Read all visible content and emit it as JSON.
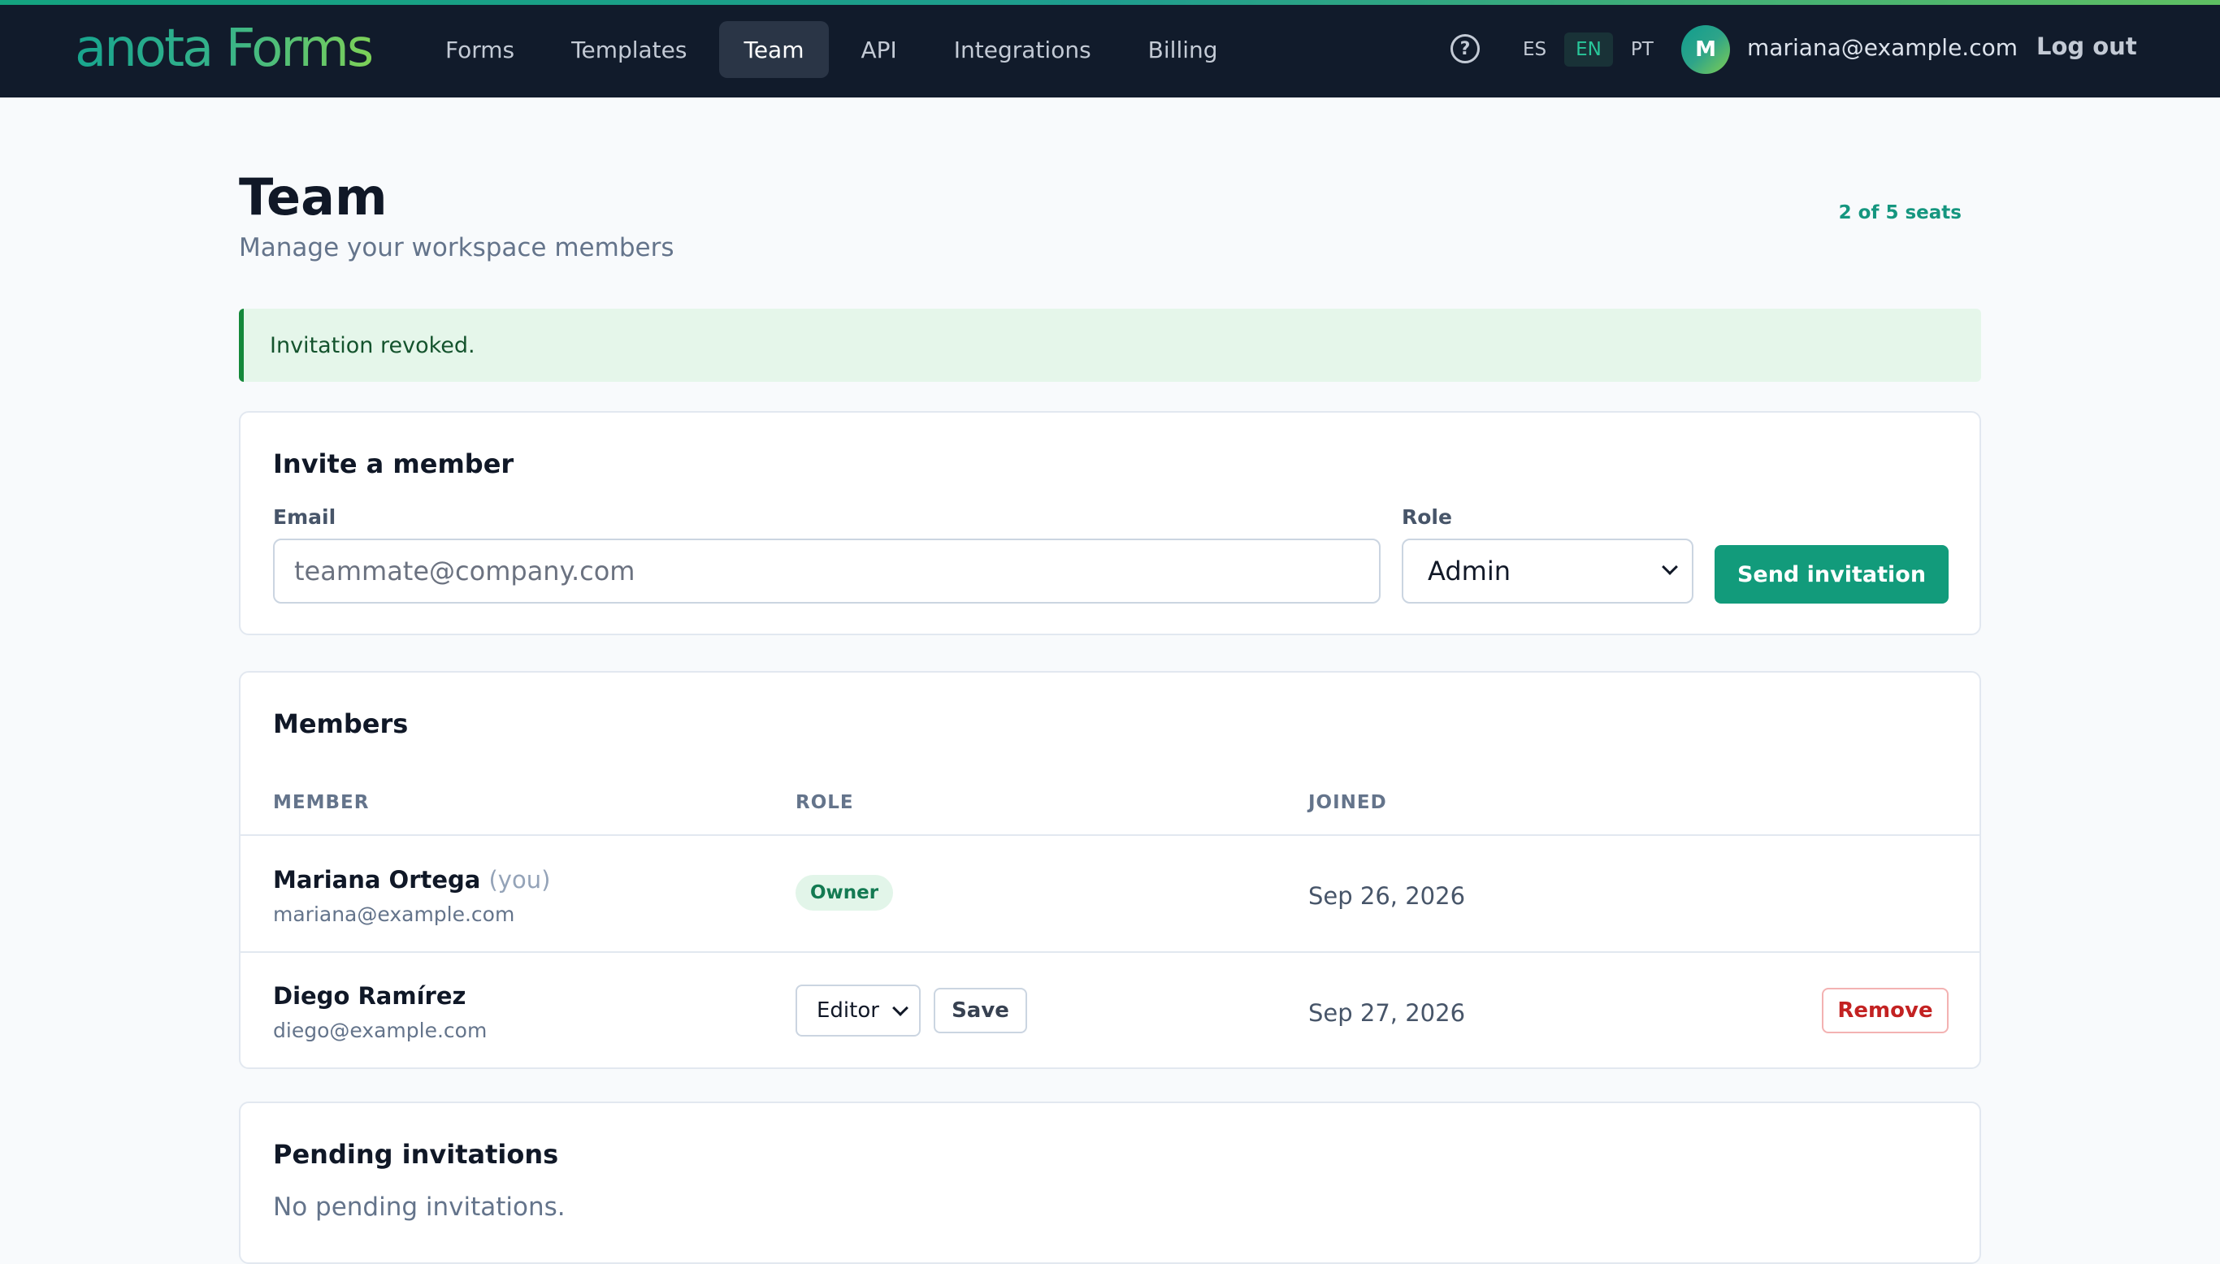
{
  "header": {
    "logo": "anota Forms",
    "nav": [
      {
        "label": "Forms",
        "active": false
      },
      {
        "label": "Templates",
        "active": false
      },
      {
        "label": "Team",
        "active": true
      },
      {
        "label": "API",
        "active": false
      },
      {
        "label": "Integrations",
        "active": false
      },
      {
        "label": "Billing",
        "active": false
      }
    ],
    "help_glyph": "?",
    "help_icon": "help-circle-icon",
    "languages": [
      {
        "code": "ES",
        "active": false
      },
      {
        "code": "EN",
        "active": true
      },
      {
        "code": "PT",
        "active": false
      }
    ],
    "avatar_initial": "M",
    "user_email": "mariana@example.com",
    "logout_label": "Log out"
  },
  "page": {
    "title": "Team",
    "subtitle": "Manage your workspace members",
    "seats": "2 of 5 seats"
  },
  "alert": {
    "message": "Invitation revoked."
  },
  "invite": {
    "title": "Invite a member",
    "email_label": "Email",
    "email_placeholder": "teammate@company.com",
    "email_value": "",
    "role_label": "Role",
    "role_value": "Admin",
    "send_label": "Send invitation"
  },
  "members": {
    "title": "Members",
    "columns": {
      "member": "MEMBER",
      "role": "ROLE",
      "joined": "JOINED"
    },
    "rows": [
      {
        "name": "Mariana Ortega",
        "you_tag": "(you)",
        "email": "mariana@example.com",
        "role_badge": "Owner",
        "joined": "Sep 26, 2026"
      },
      {
        "name": "Diego Ramírez",
        "email": "diego@example.com",
        "role_value": "Editor",
        "save_label": "Save",
        "joined": "Sep 27, 2026",
        "remove_label": "Remove"
      }
    ]
  },
  "pending": {
    "title": "Pending invitations",
    "empty_message": "No pending invitations."
  },
  "colors": {
    "topbar": "#111b2b",
    "accent": "#129b7b",
    "success_bg": "#e5f6ea",
    "danger": "#c32222"
  }
}
